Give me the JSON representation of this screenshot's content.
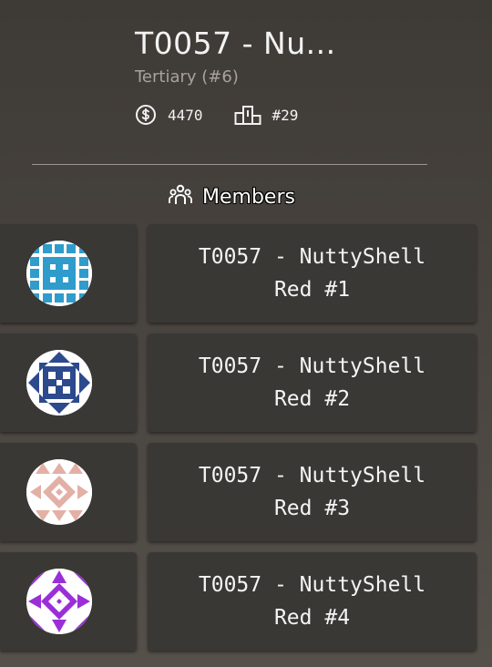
{
  "team": {
    "title": "T0057 - Nu...",
    "subtitle": "Tertiary (#6)",
    "money": "4470",
    "rank": "#29"
  },
  "section": {
    "label": "Members"
  },
  "members": [
    {
      "name": "T0057 - NuttyShell Red #1",
      "avatar": "identicon-blue"
    },
    {
      "name": "T0057 - NuttyShell Red #2",
      "avatar": "identicon-navy"
    },
    {
      "name": "T0057 - NuttyShell Red #3",
      "avatar": "identicon-pink"
    },
    {
      "name": "T0057 - NuttyShell Red #4",
      "avatar": "identicon-purple"
    }
  ],
  "icons": {
    "money": "dollar-circle-icon",
    "rank": "podium-icon",
    "members": "people-icon"
  },
  "colors": {
    "avatar_blue": "#2f9ccc",
    "avatar_navy": "#2c4a8c",
    "avatar_pink": "#e3b0a6",
    "avatar_purple": "#9a2fd8"
  }
}
